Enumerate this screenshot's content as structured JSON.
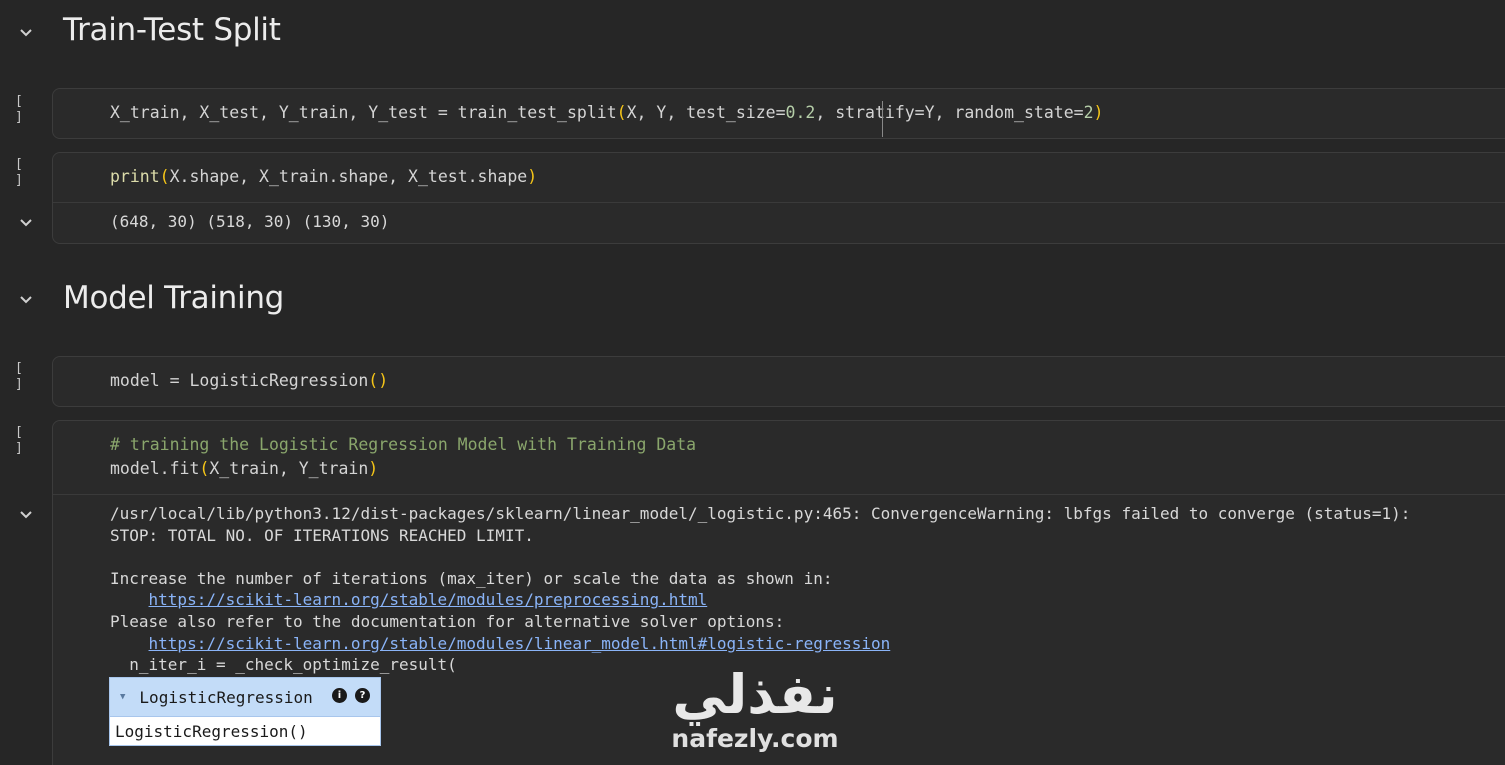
{
  "sections": [
    {
      "title": "Train-Test Split"
    },
    {
      "title": "Model Training"
    }
  ],
  "run_button_label": "[ ]",
  "cells": {
    "split": {
      "code_parts": [
        "X_train, X_test, Y_train, Y_test = train_test_split",
        "(",
        "X, Y, test_size=",
        "0.2",
        ", stratify=Y, random_state=",
        "2",
        ")"
      ]
    },
    "print_shape": {
      "code_parts": [
        "print",
        "(",
        "X.shape, X_train.shape, X_test.shape",
        ")"
      ],
      "output": "(648, 30) (518, 30) (130, 30)"
    },
    "model_def": {
      "code_parts": [
        "model = LogisticRegression",
        "()"
      ]
    },
    "model_fit": {
      "comment": "# training the Logistic Regression Model with Training Data",
      "code_parts": [
        "model.fit",
        "(",
        "X_train, Y_train",
        ")"
      ],
      "output_lines": [
        "/usr/local/lib/python3.12/dist-packages/sklearn/linear_model/_logistic.py:465: ConvergenceWarning: lbfgs failed to converge (status=1):",
        "STOP: TOTAL NO. OF ITERATIONS REACHED LIMIT.",
        "",
        "Increase the number of iterations (max_iter) or scale the data as shown in:"
      ],
      "link1": "https://scikit-learn.org/stable/modules/preprocessing.html",
      "line_after_link1": "Please also refer to the documentation for alternative solver options:",
      "link2": "https://scikit-learn.org/stable/modules/linear_model.html#logistic-regression",
      "line_after_link2": "  n_iter_i = _check_optimize_result("
    }
  },
  "estimator": {
    "title": "LogisticRegression",
    "info_icon": "i",
    "help_icon": "?",
    "body": "LogisticRegression()"
  },
  "watermark": {
    "arabic": "نفذلي",
    "latin": "nafezly.com"
  },
  "icons": {
    "collapse": "chevron-down-icon",
    "info": "info-icon",
    "help": "help-icon",
    "triangle": "triangle-down-icon"
  }
}
